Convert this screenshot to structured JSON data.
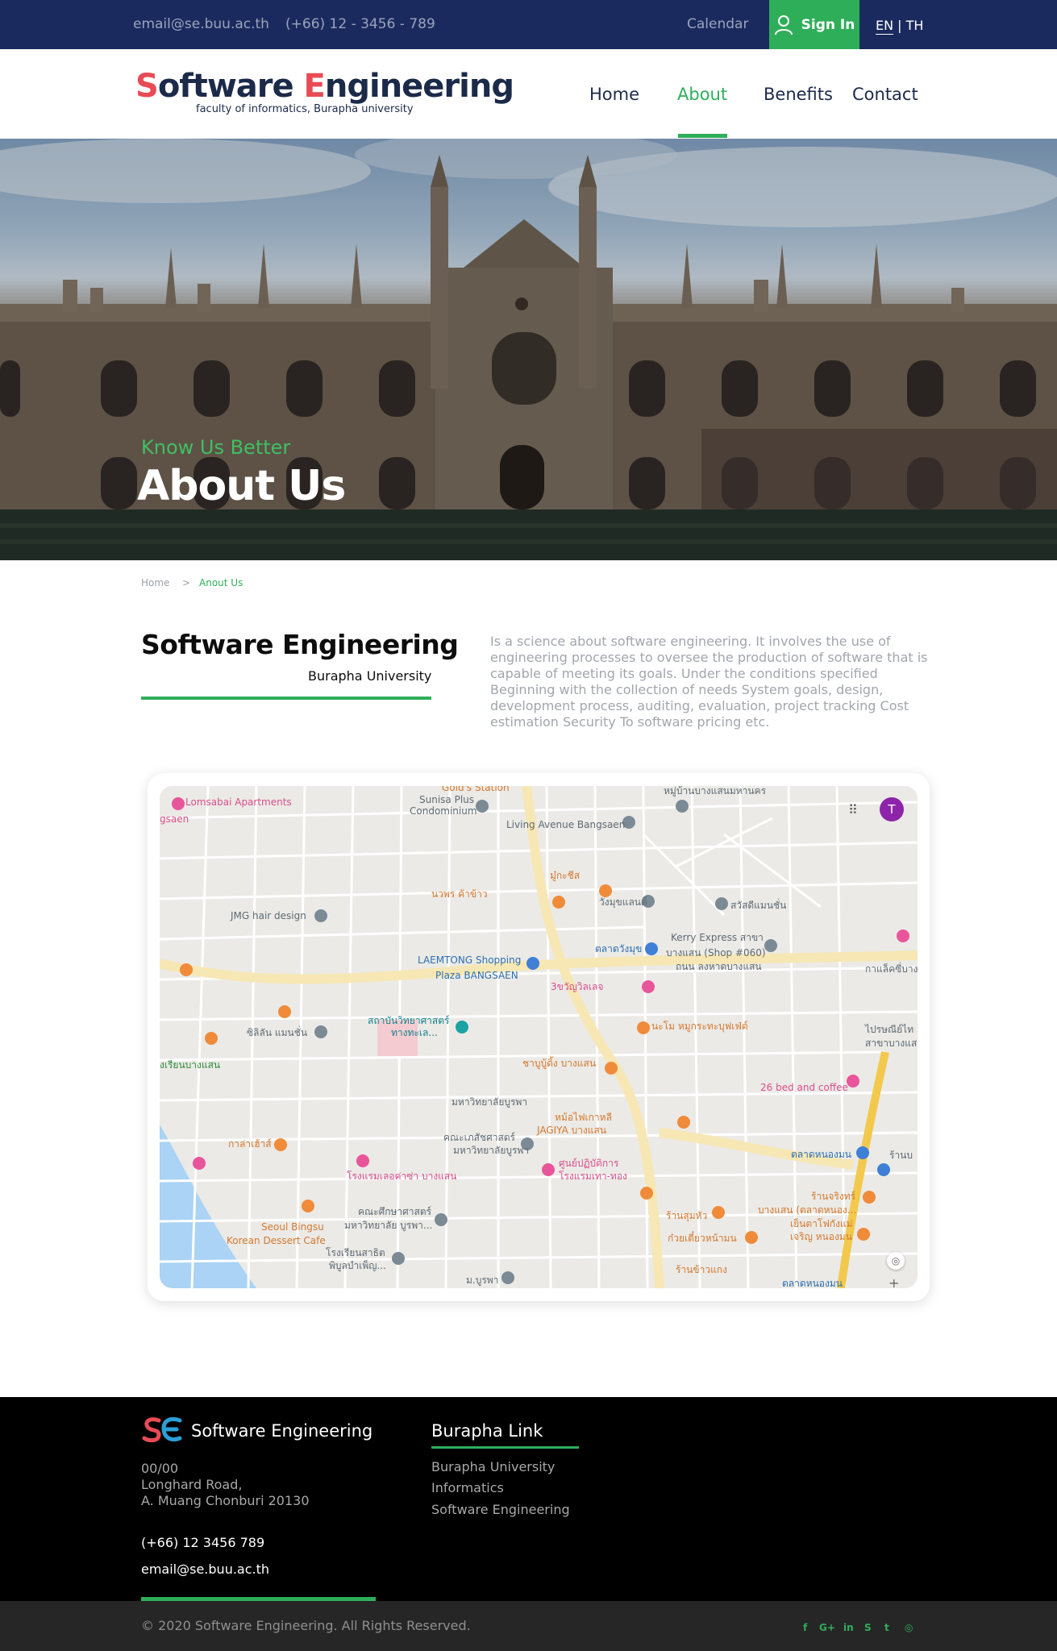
{
  "topbar": {
    "email": "email@se.buu.ac.th",
    "phone": "(+66) 12 - 3456 - 789",
    "calendar": "Calendar",
    "signin": "Sign In",
    "lang_en": "EN",
    "lang_sep": "|",
    "lang_th": "TH"
  },
  "brand": {
    "logo_first_letter": "S",
    "logo_part1": "oftware ",
    "logo_second_letter": "E",
    "logo_part2": "ngineering",
    "subtitle": "faculty of informatics, Burapha university"
  },
  "nav": {
    "items": [
      {
        "label": "Home"
      },
      {
        "label": "About"
      },
      {
        "label": "Benefits"
      },
      {
        "label": "Contact"
      }
    ],
    "active": "About"
  },
  "hero": {
    "eyebrow": "Know Us Better",
    "title": "About Us"
  },
  "breadcrumb": {
    "home": "Home",
    "separator": ">",
    "current": "Anout Us"
  },
  "about": {
    "title": "Software Engineering",
    "subtitle": "Burapha University",
    "description": "Is a science about software engineering. It involves the use of engineering processes to oversee the production of software that is capable of meeting its goals. Under the conditions specified Beginning with the collection of needs System goals, design, development process, auditing, evaluation, project tracking Cost estimation Security To software pricing etc."
  },
  "map": {
    "avatar_letter": "T",
    "grid_icon": "apps-grid-icon",
    "labels": [
      "Lomsabai Apartments",
      "gsaen",
      "Sunisa Plus",
      "Condominium",
      "Living Avenue Bangsaen",
      "หมู่บ้านบางแสนมหานคร",
      "นวพร ค้าข้าว",
      "มู๋กะชีส",
      "วังมุขแลนด์",
      "สวัสดีแมนชั่น",
      "JMG hair design",
      "Kerry Express สาขา",
      "ตลาดวังมุข",
      "บางแสน (Shop #060)",
      "LAEMTONG Shopping",
      "Plaza BANGSAEN",
      "ถนน ลงหาดบางแสน",
      "3ขวัญวิลเลจ",
      "กาแล็คซี่บาง",
      "สถาบันวิทยาศาสตร์",
      "ทางทะเล...",
      "ซิลิลัน แมนชั่น",
      "นะโม หมูกระทะบุฟเฟ่ต์",
      "ไปรษณีย์ไท",
      "สาขาบางแสน",
      "งเรียนบางแสน",
      "ชาบูบู้ดิ้ง บางแสน",
      "26 bed and coffee",
      "มหาวิทยาลัยบูรพา",
      "หม้อไฟเกาหลี",
      "JAGIYA บางแสน",
      "กาล่าเฮ้าส์",
      "คณะเภสัชศาสตร์",
      "มหาวิทยาลัยบูรพา",
      "ตลาดหนองมน",
      "ศูนย์ปฏิบัติการ",
      "โรงแรมเทา-ทอง",
      "โรงแรมเลอค่าซ่า บางแสน",
      "ร้านจริงทร์",
      "Seoul Bingsu",
      "Korean Dessert Cafe",
      "คณะศึกษาศาสตร์",
      "มหาวิทยาลัย บูรพา...",
      "ร้านสุมหัว",
      "บางแสน (ตลาดหนอง...",
      "เย็นตาโฟกังแม่",
      "เจริญ หนองมน",
      "ก๋วยเตี๋ยวหน้ามน",
      "โรงเรียนสาธิต",
      "พิบูลบำเพ็ญ...",
      "ร้านข้าวแกง",
      "ม.บูรพา",
      "ตลาดหนองมน",
      "Gold's Station",
      "ร้านบ"
    ]
  },
  "footer": {
    "brand": "Software Engineering",
    "address_line1": "00/00",
    "address_line2": "Longhard Road,",
    "address_line3": "A. Muang Chonburi 20130",
    "phone": "(+66) 12 3456 789",
    "email": "email@se.buu.ac.th",
    "links_title": "Burapha Link",
    "links": [
      {
        "label": "Burapha University"
      },
      {
        "label": "Informatics"
      },
      {
        "label": "Software Engineering"
      }
    ],
    "copyright": "© 2020 Software Engineering. All Rights Reserved.",
    "social": [
      {
        "icon": "facebook-icon",
        "glyph": "f"
      },
      {
        "icon": "google-plus-icon",
        "glyph": "G+"
      },
      {
        "icon": "linkedin-icon",
        "glyph": "in"
      },
      {
        "icon": "skype-icon",
        "glyph": "S"
      },
      {
        "icon": "twitter-icon",
        "glyph": "t"
      },
      {
        "icon": "instagram-icon",
        "glyph": "◎"
      }
    ]
  },
  "colors": {
    "navy": "#1b2a5e",
    "green": "#2fae5a",
    "logo_red": "#e84b55",
    "footer_bg": "#000000"
  }
}
